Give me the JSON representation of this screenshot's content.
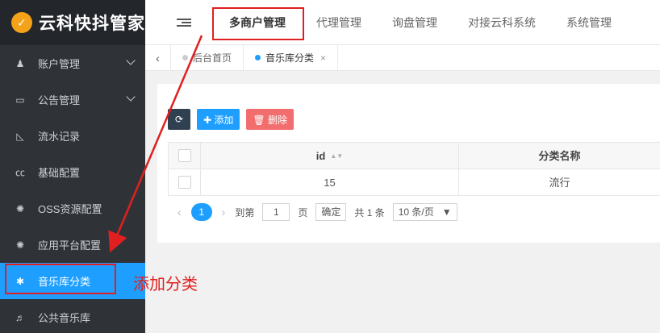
{
  "brand": {
    "logo_glyph": "✓",
    "title": "云科快抖管家"
  },
  "sidebar": {
    "items": [
      {
        "icon": "user-icon",
        "glyph": "♟",
        "label": "账户管理",
        "has_chevron": true
      },
      {
        "icon": "card-icon",
        "glyph": "▭",
        "label": "公告管理",
        "has_chevron": true
      },
      {
        "icon": "chart-icon",
        "glyph": "◺",
        "label": "流水记录",
        "has_chevron": false
      },
      {
        "icon": "cc-icon",
        "glyph": "㏄",
        "label": "基础配置",
        "has_chevron": false
      },
      {
        "icon": "gear-icon",
        "glyph": "✺",
        "label": "OSS资源配置",
        "has_chevron": false
      },
      {
        "icon": "gear-icon",
        "glyph": "✺",
        "label": "应用平台配置",
        "has_chevron": false
      },
      {
        "icon": "asterisk-icon",
        "glyph": "✱",
        "label": "音乐库分类",
        "has_chevron": false,
        "active": true
      },
      {
        "icon": "music-icon",
        "glyph": "♬",
        "label": "公共音乐库",
        "has_chevron": false
      }
    ]
  },
  "topnav": {
    "items": [
      "多商户管理",
      "代理管理",
      "询盘管理",
      "对接云科系统",
      "系统管理"
    ]
  },
  "tabs": {
    "prev_glyph": "‹",
    "items": [
      {
        "label": "后台首页"
      },
      {
        "label": "音乐库分类",
        "close": "×"
      }
    ]
  },
  "toolbar": {
    "refresh_glyph": "⟳",
    "add_label": "✚ 添加",
    "delete_label": "🗑 删除"
  },
  "table": {
    "columns": [
      "id",
      "分类名称"
    ],
    "sort_glyph": "▲▼",
    "rows": [
      {
        "id": "15",
        "name": "流行"
      }
    ]
  },
  "pager": {
    "prev": "‹",
    "current": "1",
    "next": "›",
    "goto_label": "到第",
    "goto_value": "1",
    "page_unit": "页",
    "confirm": "确定",
    "total": "共 1 条",
    "page_size": "10 条/页",
    "select_arrow": "▼"
  },
  "annotation": {
    "text": "添加分类",
    "color": "#e02020"
  },
  "colors": {
    "sidebar_bg": "#2f3338",
    "accent": "#1e9fff",
    "delete": "#f26d6d",
    "refresh": "#2f4050"
  }
}
